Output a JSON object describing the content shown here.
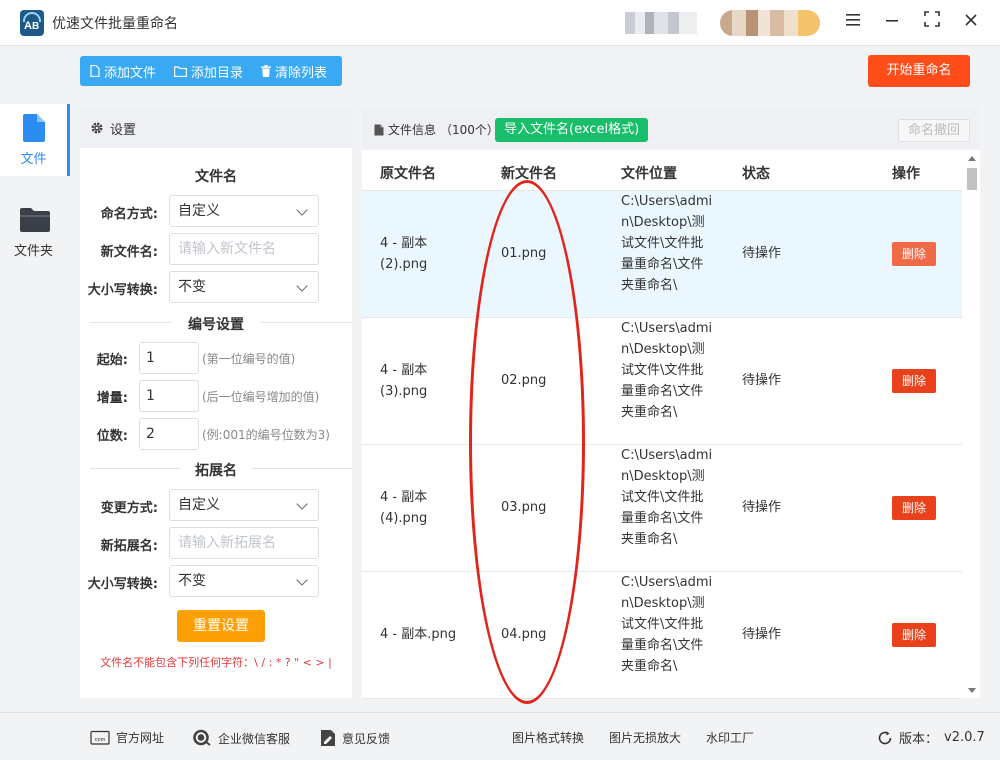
{
  "app": {
    "title": "优速文件批量重命名"
  },
  "window": {
    "menu_icon": "menu-icon",
    "min_icon": "minimize-icon",
    "max_icon": "maximize-icon",
    "close_icon": "close-icon"
  },
  "nav": {
    "items": [
      {
        "label": "文件",
        "icon": "file-icon",
        "active": true
      },
      {
        "label": "文件夹",
        "icon": "folder-icon",
        "active": false
      }
    ]
  },
  "toolbar": {
    "add_file": "添加文件",
    "add_dir": "添加目录",
    "clear_list": "清除列表",
    "start": "开始重命名"
  },
  "settings": {
    "header": "设置",
    "filename_section": "文件名",
    "naming_mode_label": "命名方式:",
    "naming_mode_value": "自定义",
    "new_name_label": "新文件名:",
    "new_name_placeholder": "请输入新文件名",
    "case_label": "大小写转换:",
    "case_value": "不变",
    "numbering_section": "编号设置",
    "start_label": "起始:",
    "start_value": "1",
    "start_hint": "(第一位编号的值)",
    "step_label": "增量:",
    "step_value": "1",
    "step_hint": "(后一位编号增加的值)",
    "digits_label": "位数:",
    "digits_value": "2",
    "digits_hint": "(例:001的编号位数为3)",
    "ext_section": "拓展名",
    "ext_mode_label": "变更方式:",
    "ext_mode_value": "自定义",
    "new_ext_label": "新拓展名:",
    "new_ext_placeholder": "请输入新拓展名",
    "ext_case_label": "大小写转换:",
    "ext_case_value": "不变",
    "reset_button": "重置设置",
    "warning": "文件名不能包含下列任何字符：\\ / : * ? \" < > |"
  },
  "files": {
    "info_label": "文件信息",
    "count": "（100个）",
    "import_button": "导入文件名(excel格式)",
    "undo_button": "命名撤回",
    "columns": {
      "original": "原文件名",
      "new": "新文件名",
      "location": "文件位置",
      "status": "状态",
      "action": "操作"
    },
    "rows": [
      {
        "original": "4 - 副本 (2).png",
        "new": "01.png",
        "location": "C:\\Users\\admin\\Desktop\\测试文件\\文件批量重命名\\文件夹重命名\\",
        "status": "待操作",
        "action": "删除"
      },
      {
        "original": "4 - 副本 (3).png",
        "new": "02.png",
        "location": "C:\\Users\\admin\\Desktop\\测试文件\\文件批量重命名\\文件夹重命名\\",
        "status": "待操作",
        "action": "删除"
      },
      {
        "original": "4 - 副本 (4).png",
        "new": "03.png",
        "location": "C:\\Users\\admin\\Desktop\\测试文件\\文件批量重命名\\文件夹重命名\\",
        "status": "待操作",
        "action": "删除"
      },
      {
        "original": "4 - 副本.png",
        "new": "04.png",
        "location": "C:\\Users\\admin\\Desktop\\测试文件\\文件批量重命名\\文件夹重命名\\",
        "status": "待操作",
        "action": "删除"
      }
    ]
  },
  "footer": {
    "website": "官方网址",
    "support": "企业微信客服",
    "feedback": "意见反馈",
    "img_convert": "图片格式转换",
    "img_enlarge": "图片无损放大",
    "watermark": "水印工厂",
    "version_label": "版本：",
    "version": "v2.0.7"
  },
  "colors": {
    "accent": "#2d8cf0",
    "toolbar": "#3aa9f3",
    "start": "#ff4d1a",
    "import": "#19be6b",
    "reset": "#ff9f06",
    "delete_active": "#f06a48",
    "delete": "#e8411c",
    "annotation": "#e0251b"
  }
}
